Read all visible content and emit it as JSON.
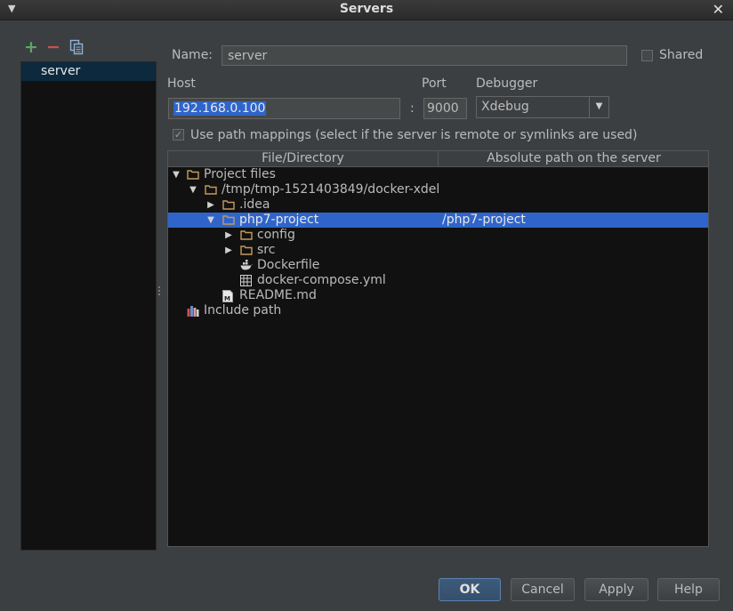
{
  "window": {
    "title": "Servers",
    "menu_icon": "chevron-down-icon",
    "close_icon": "close-icon"
  },
  "toolbar": {
    "add_icon": "plus-icon",
    "remove_icon": "minus-icon",
    "copy_icon": "copy-icon"
  },
  "sidebar": {
    "items": [
      {
        "label": "server",
        "selected": true
      }
    ]
  },
  "form": {
    "name_label": "Name:",
    "name_value": "server",
    "shared_label": "Shared",
    "shared_checked": false,
    "host_label": "Host",
    "host_value": "192.168.0.100",
    "colon": ":",
    "port_label": "Port",
    "port_value": "9000",
    "debugger_label": "Debugger",
    "debugger_value": "Xdebug",
    "use_mappings_label": "Use path mappings (select if the server is remote or symlinks are used)",
    "use_mappings_checked": true
  },
  "table": {
    "columns": [
      "File/Directory",
      "Absolute path on the server"
    ],
    "rows": [
      {
        "label": "Project files",
        "icon": "folder-icon",
        "expanded": true,
        "mapping": ""
      },
      {
        "label": "/tmp/tmp-1521403849/docker-xdel",
        "icon": "folder-icon",
        "expanded": true,
        "mapping": ""
      },
      {
        "label": ".idea",
        "icon": "folder-icon",
        "expanded": false,
        "mapping": ""
      },
      {
        "label": "php7-project",
        "icon": "folder-icon",
        "expanded": true,
        "selected": true,
        "mapping": "/php7-project"
      },
      {
        "label": "config",
        "icon": "folder-icon",
        "expanded": false,
        "mapping": ""
      },
      {
        "label": "src",
        "icon": "folder-icon",
        "expanded": false,
        "mapping": ""
      },
      {
        "label": "Dockerfile",
        "icon": "docker-icon",
        "mapping": ""
      },
      {
        "label": "docker-compose.yml",
        "icon": "yaml-file-icon",
        "mapping": ""
      },
      {
        "label": "README.md",
        "icon": "markdown-file-icon",
        "mapping": ""
      },
      {
        "label": "Include path",
        "icon": "library-icon",
        "mapping": ""
      }
    ]
  },
  "buttons": {
    "ok": "OK",
    "cancel": "Cancel",
    "apply": "Apply",
    "help": "Help"
  },
  "colors": {
    "selection": "#2f65ca",
    "folder": "#c69a5a",
    "add": "#59a869",
    "remove": "#c75450"
  }
}
